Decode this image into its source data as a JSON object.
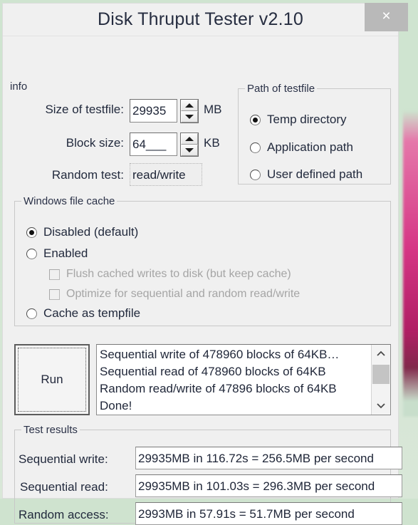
{
  "window": {
    "title": "Disk Thruput Tester v2.10",
    "close_label": "×",
    "close_icon": "close-icon"
  },
  "info": {
    "group_title": "info",
    "fields": [
      {
        "label": "Size of testfile:",
        "value": "29935",
        "unit": "MB",
        "spinner": true
      },
      {
        "label": "Block size:",
        "value": "64___",
        "unit": "KB",
        "spinner": true
      },
      {
        "label": "Random test:",
        "value": "read/write",
        "unit": "",
        "spinner": false
      }
    ]
  },
  "path_group": {
    "title": "Path of testfile",
    "options": [
      {
        "label": "Temp directory",
        "checked": true
      },
      {
        "label": "Application path",
        "checked": false
      },
      {
        "label": "User defined path",
        "checked": false
      }
    ]
  },
  "cache_group": {
    "title": "Windows file cache",
    "radios": [
      {
        "label": "Disabled (default)",
        "checked": true
      },
      {
        "label": "Enabled",
        "checked": false
      },
      {
        "label": "Cache as tempfile",
        "checked": false
      }
    ],
    "checkboxes": [
      {
        "label": "Flush cached writes to disk (but keep cache)",
        "checked": false,
        "disabled": true
      },
      {
        "label": "Optimize for sequential and random read/write",
        "checked": false,
        "disabled": true
      }
    ]
  },
  "run": {
    "label": "Run"
  },
  "log": {
    "lines": [
      "Sequential write of 478960 blocks of 64KB…",
      "Sequential read of 478960 blocks of 64KB",
      "Random read/write of 47896 blocks of 64KB",
      "Done!"
    ],
    "scroll_up_icon": "chevron-up-icon",
    "scroll_down_icon": "chevron-down-icon",
    "scroll_up": "⌃",
    "scroll_down": "⌄"
  },
  "results": {
    "group_title": "Test results",
    "rows": [
      {
        "label": "Sequential write:",
        "value": "29935MB in 116.72s = 256.5MB per second"
      },
      {
        "label": "Sequential read:",
        "value": "29935MB in 101.03s = 296.3MB per second"
      },
      {
        "label": "Random access:",
        "value": "2993MB in 57.91s = 51.7MB per second"
      }
    ]
  },
  "colors": {
    "window_bg": "#f0f0f0",
    "title_text": "#262d40",
    "close_bg": "#b9b9b9",
    "desktop_green": "#cfe4d0",
    "desktop_pink": "#d63685"
  }
}
